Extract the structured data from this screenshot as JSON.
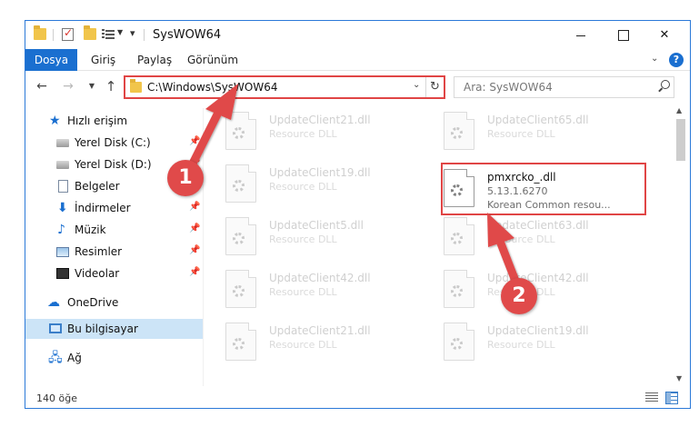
{
  "window": {
    "title": "SysWOW64"
  },
  "ribbon": {
    "tabs": [
      "Dosya",
      "Giriş",
      "Paylaş",
      "Görünüm"
    ],
    "help": "?"
  },
  "address": {
    "path": "C:\\Windows\\SysWOW64"
  },
  "search": {
    "placeholder": "Ara: SysWOW64"
  },
  "sidebar": {
    "items": [
      {
        "label": "Hızlı erişim",
        "icon": "star-icon"
      },
      {
        "label": "Yerel Disk (C:)",
        "icon": "drive-icon"
      },
      {
        "label": "Yerel Disk (D:)",
        "icon": "drive-icon"
      },
      {
        "label": "Belgeler",
        "icon": "documents-icon"
      },
      {
        "label": "İndirmeler",
        "icon": "download-icon"
      },
      {
        "label": "Müzik",
        "icon": "music-icon"
      },
      {
        "label": "Resimler",
        "icon": "pictures-icon"
      },
      {
        "label": "Videolar",
        "icon": "videos-icon"
      },
      {
        "label": "OneDrive",
        "icon": "cloud-icon"
      },
      {
        "label": "Bu bilgisayar",
        "icon": "computer-icon"
      },
      {
        "label": "Ağ",
        "icon": "network-icon"
      }
    ]
  },
  "files": {
    "left": [
      {
        "name": "UpdateClient21.dll",
        "desc": "Resource DLL"
      },
      {
        "name": "UpdateClient19.dll",
        "desc": "Resource DLL"
      },
      {
        "name": "UpdateClient5.dll",
        "desc": "Resource DLL"
      },
      {
        "name": "UpdateClient42.dll",
        "desc": "Resource DLL"
      },
      {
        "name": "UpdateClient21.dll",
        "desc": "Resource DLL"
      }
    ],
    "right": [
      {
        "name": "UpdateClient65.dll",
        "desc": "Resource DLL"
      },
      {
        "name": "UpdateClient63.dll",
        "desc": "Resource DLL"
      },
      {
        "name": "UpdateClient42.dll",
        "desc": "Resource DLL"
      },
      {
        "name": "UpdateClient19.dll",
        "desc": "Resource DLL"
      }
    ],
    "highlighted": {
      "name": "pmxrcko_.dll",
      "version": "5.13.1.6270",
      "desc": "Korean Common resou..."
    }
  },
  "status": {
    "count": "140 öğe"
  },
  "annotations": [
    "1",
    "2"
  ],
  "colors": {
    "accent": "#1a6fd0",
    "highlight_red": "#e04545",
    "selected": "#cce4f7"
  }
}
